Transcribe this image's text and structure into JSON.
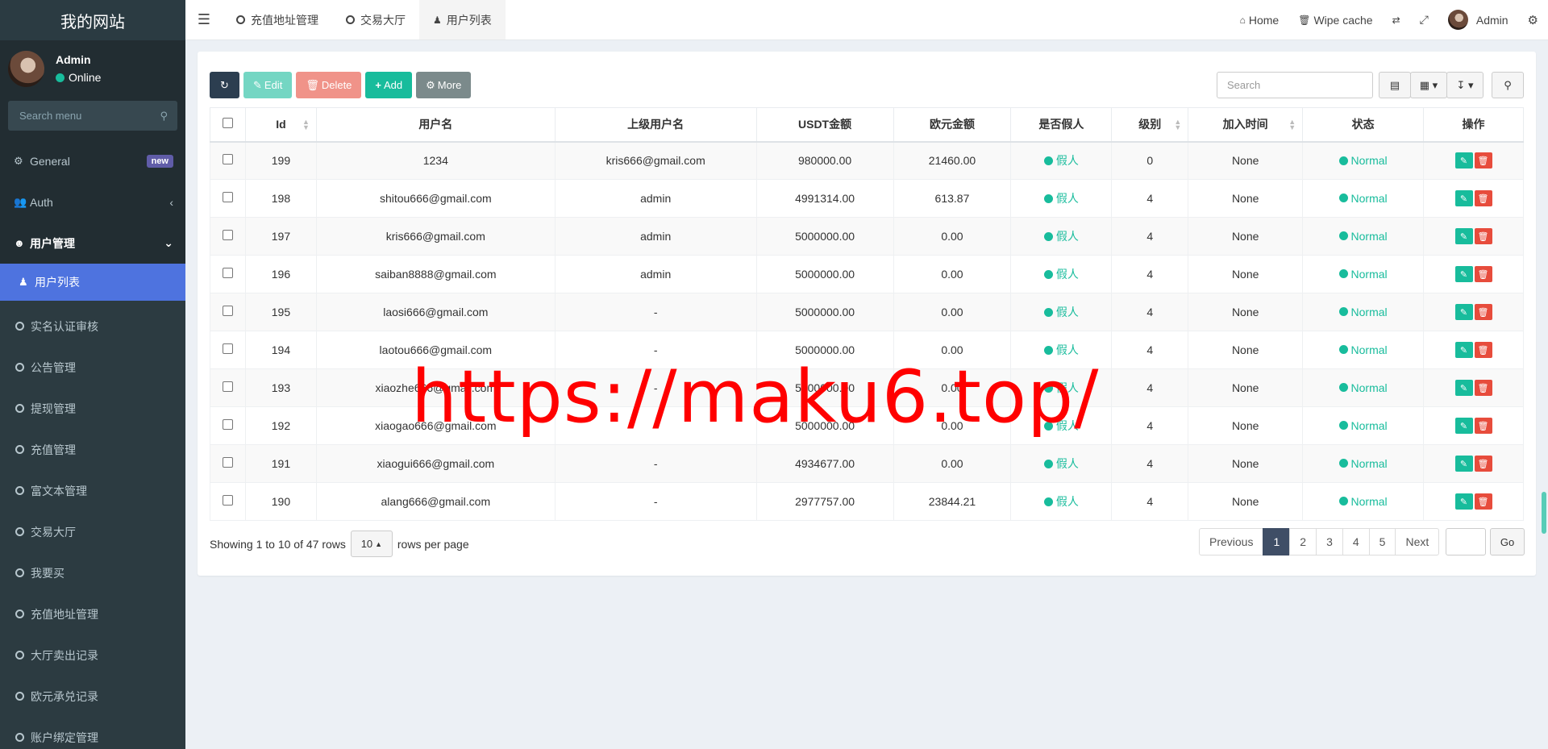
{
  "sidebar": {
    "brand": "我的网站",
    "user": {
      "name": "Admin",
      "status": "Online"
    },
    "search_placeholder": "Search menu",
    "items": [
      {
        "label": "General",
        "badge": "new"
      },
      {
        "label": "Auth"
      },
      {
        "label": "用户管理"
      }
    ],
    "active_item": "用户列表",
    "sub_items": [
      "实名认证审核",
      "公告管理",
      "提现管理",
      "充值管理",
      "富文本管理",
      "交易大厅",
      "我要买",
      "充值地址管理",
      "大厅卖出记录",
      "欧元承兑记录",
      "账户绑定管理"
    ]
  },
  "topbar": {
    "tabs": [
      "充值地址管理",
      "交易大厅",
      "用户列表"
    ],
    "home": "Home",
    "wipe_cache": "Wipe cache",
    "admin": "Admin"
  },
  "toolbar": {
    "edit": "Edit",
    "delete": "Delete",
    "add": "Add",
    "more": "More",
    "search_placeholder": "Search"
  },
  "table": {
    "columns": [
      "Id",
      "用户名",
      "上级用户名",
      "USDT金额",
      "欧元金额",
      "是否假人",
      "级别",
      "加入时间",
      "状态",
      "操作"
    ],
    "rows": [
      {
        "id": "199",
        "username": "1234",
        "parent": "kris666@gmail.com",
        "usdt": "980000.00",
        "eur": "21460.00",
        "fake": "假人",
        "level": "0",
        "join": "None",
        "status": "Normal"
      },
      {
        "id": "198",
        "username": "shitou666@gmail.com",
        "parent": "admin",
        "usdt": "4991314.00",
        "eur": "613.87",
        "fake": "假人",
        "level": "4",
        "join": "None",
        "status": "Normal"
      },
      {
        "id": "197",
        "username": "kris666@gmail.com",
        "parent": "admin",
        "usdt": "5000000.00",
        "eur": "0.00",
        "fake": "假人",
        "level": "4",
        "join": "None",
        "status": "Normal"
      },
      {
        "id": "196",
        "username": "saiban8888@gmail.com",
        "parent": "admin",
        "usdt": "5000000.00",
        "eur": "0.00",
        "fake": "假人",
        "level": "4",
        "join": "None",
        "status": "Normal"
      },
      {
        "id": "195",
        "username": "laosi666@gmail.com",
        "parent": "-",
        "usdt": "5000000.00",
        "eur": "0.00",
        "fake": "假人",
        "level": "4",
        "join": "None",
        "status": "Normal"
      },
      {
        "id": "194",
        "username": "laotou666@gmail.com",
        "parent": "-",
        "usdt": "5000000.00",
        "eur": "0.00",
        "fake": "假人",
        "level": "4",
        "join": "None",
        "status": "Normal"
      },
      {
        "id": "193",
        "username": "xiaozhe666@gmail.com",
        "parent": "-",
        "usdt": "5000000.00",
        "eur": "0.00",
        "fake": "假人",
        "level": "4",
        "join": "None",
        "status": "Normal"
      },
      {
        "id": "192",
        "username": "xiaogao666@gmail.com",
        "parent": "-",
        "usdt": "5000000.00",
        "eur": "0.00",
        "fake": "假人",
        "level": "4",
        "join": "None",
        "status": "Normal"
      },
      {
        "id": "191",
        "username": "xiaogui666@gmail.com",
        "parent": "-",
        "usdt": "4934677.00",
        "eur": "0.00",
        "fake": "假人",
        "level": "4",
        "join": "None",
        "status": "Normal"
      },
      {
        "id": "190",
        "username": "alang666@gmail.com",
        "parent": "-",
        "usdt": "2977757.00",
        "eur": "23844.21",
        "fake": "假人",
        "level": "4",
        "join": "None",
        "status": "Normal"
      }
    ]
  },
  "footer": {
    "showing": "Showing 1 to 10 of 47 rows",
    "page_size": "10",
    "rows_per_page": "rows per page",
    "previous": "Previous",
    "pages": [
      "1",
      "2",
      "3",
      "4",
      "5"
    ],
    "next": "Next",
    "go": "Go"
  },
  "watermark": "https://maku6.top/",
  "colors": {
    "sidebar_bg": "#222d32",
    "active_blue": "#4e73df",
    "success": "#18bc9c",
    "danger": "#e74c3c",
    "dark_btn": "#2c3e50"
  }
}
